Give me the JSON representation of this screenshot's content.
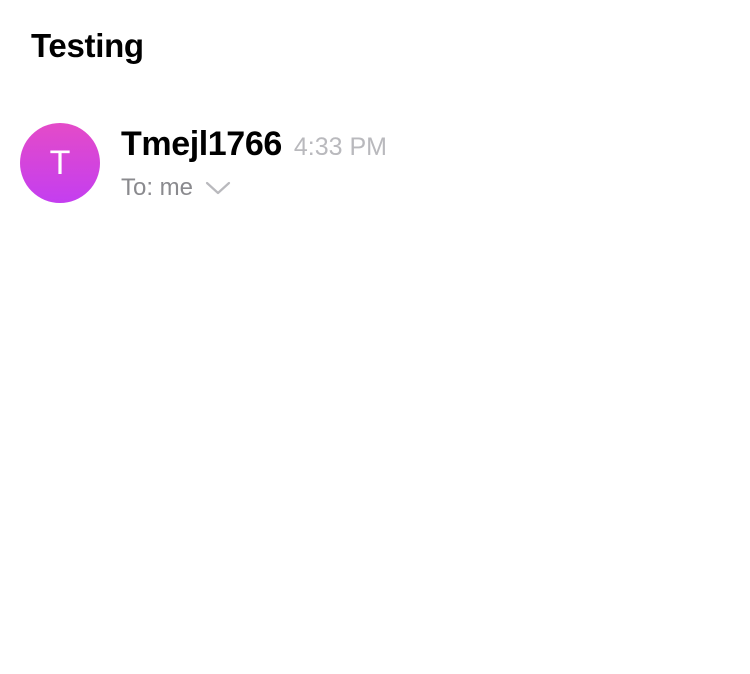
{
  "email": {
    "subject": "Testing",
    "sender": {
      "avatar_initial": "T",
      "name": "Tmejl1766",
      "time": "4:33 PM",
      "recipients": "To: me"
    }
  },
  "icons": {
    "expand_recipients": "chevron-down-icon"
  },
  "colors": {
    "avatar_gradient_top": "#e44bc8",
    "avatar_gradient_bottom": "#c43ef0",
    "secondary_text": "#8a8a8e",
    "time_text": "#b9b9bd"
  }
}
